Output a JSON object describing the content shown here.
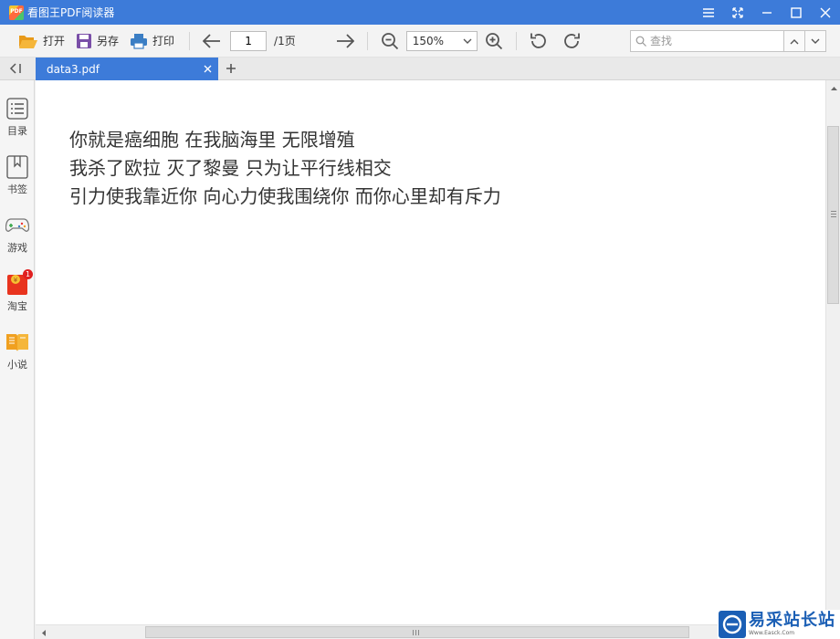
{
  "window": {
    "app_logo_text": "PDF",
    "title": "看图王PDF阅读器"
  },
  "toolbar": {
    "open_label": "打开",
    "saveas_label": "另存",
    "print_label": "打印",
    "page_current": "1",
    "page_total": "/1页",
    "zoom_value": "150%",
    "search_placeholder": "查找"
  },
  "tabs": [
    {
      "label": "data3.pdf",
      "active": true
    }
  ],
  "sidebar": {
    "items": [
      {
        "label": "目录",
        "icon": "list-icon"
      },
      {
        "label": "书签",
        "icon": "bookmark-icon"
      },
      {
        "label": "游戏",
        "icon": "gamepad-icon"
      },
      {
        "label": "淘宝",
        "icon": "taobao-bag-icon",
        "badge": "1"
      },
      {
        "label": "小说",
        "icon": "book-icon"
      }
    ]
  },
  "document": {
    "lines": [
      "你就是癌细胞  在我脑海里  无限增殖",
      "我杀了欧拉  灭了黎曼  只为让平行线相交",
      "引力使我靠近你  向心力使我围绕你  而你心里却有斥力"
    ]
  },
  "watermark": {
    "text": "易采站长站",
    "sub": "Www.Easck.Com"
  },
  "colors": {
    "accent": "#3d7bd9",
    "icon_gray": "#555555",
    "folder_orange": "#f0a020",
    "save_purple": "#7a4fa8",
    "print_blue": "#3b7ec4"
  }
}
